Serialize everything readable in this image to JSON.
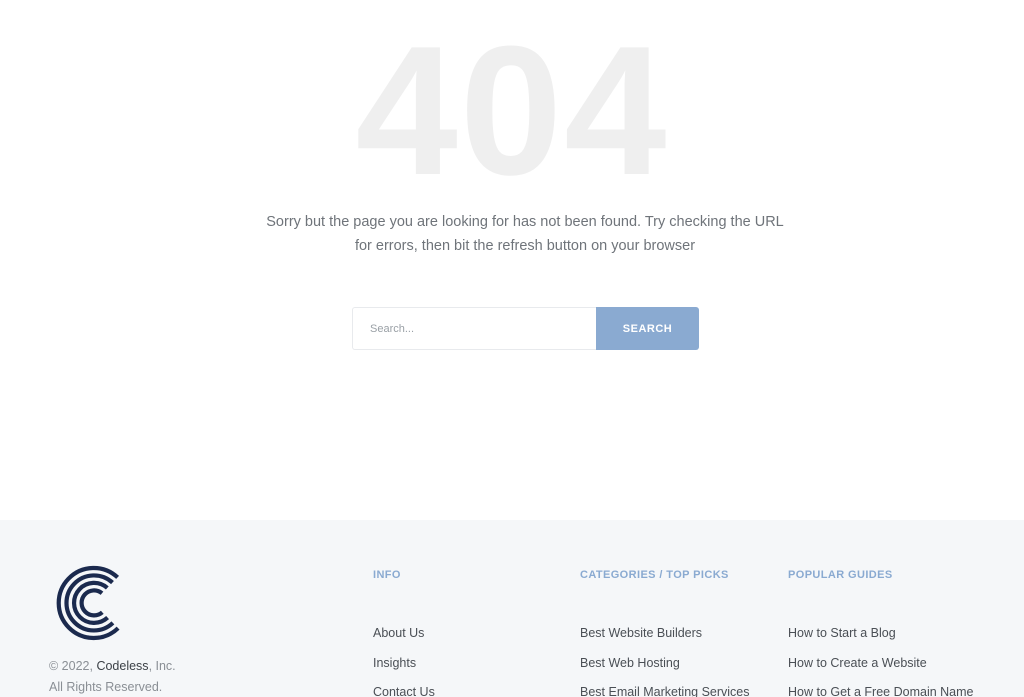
{
  "hero": {
    "code": "404",
    "message_line1": "Sorry but the page you are looking for has not been found. Try checking the URL",
    "message_line2": "for errors, then bit the refresh button on your browser"
  },
  "search": {
    "placeholder": "Search...",
    "button_label": "SEARCH"
  },
  "footer": {
    "copyright_prefix": "© 2022, ",
    "brand": "Codeless",
    "copyright_suffix": ", Inc.",
    "rights": "All Rights Reserved.",
    "columns": [
      {
        "title": "INFO",
        "links": [
          "About Us",
          "Insights",
          "Contact Us"
        ]
      },
      {
        "title": "CATEGORIES / TOP PICKS",
        "links": [
          "Best Website Builders",
          "Best Web Hosting",
          "Best Email Marketing Services"
        ]
      },
      {
        "title": "POPULAR GUIDES",
        "links": [
          "How to Start a Blog",
          "How to Create a Website",
          "How to Get a Free Domain Name"
        ]
      }
    ]
  },
  "colors": {
    "accent": "#8aaad1",
    "logo": "#1b2a4e",
    "footer_bg": "#f5f7f9",
    "big_code": "#efefef"
  }
}
